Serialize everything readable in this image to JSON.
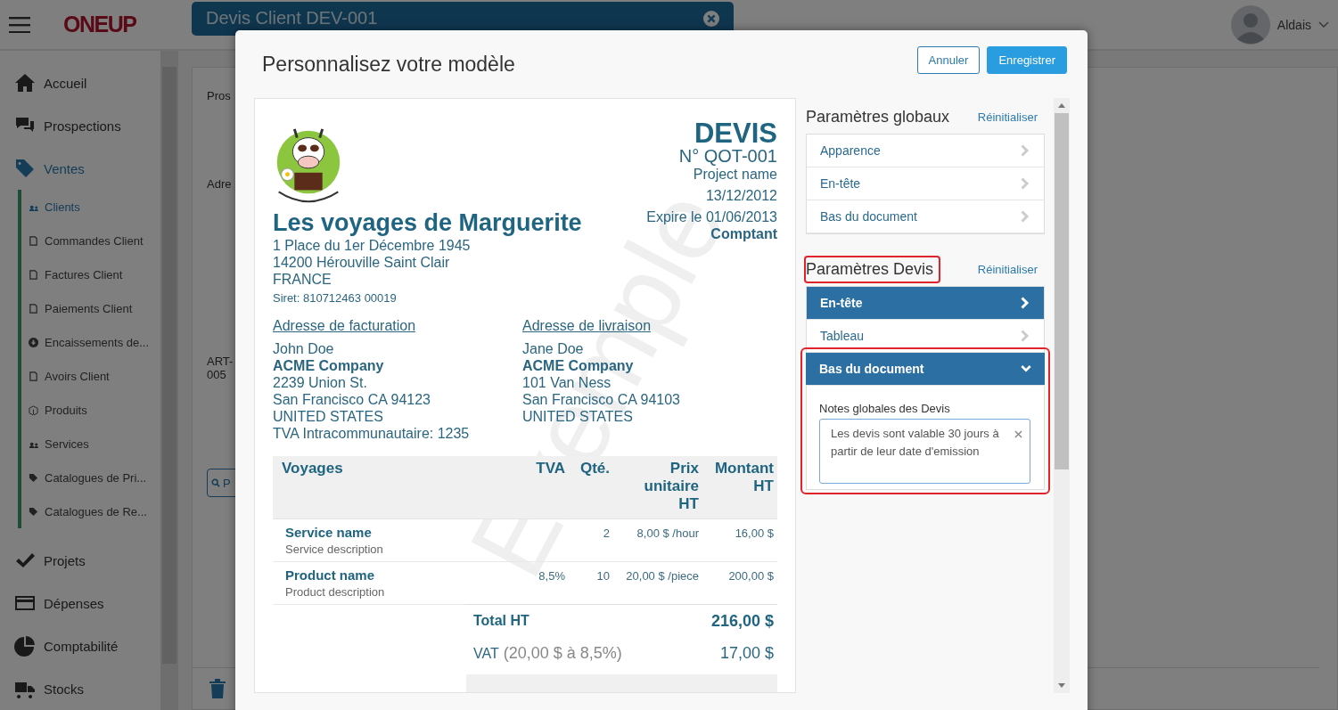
{
  "app": {
    "brand": "ONEUP",
    "tab_title": "Devis Client DEV-001",
    "user": "Aldais"
  },
  "sidebar": {
    "items": [
      {
        "label": "Accueil",
        "selected": false
      },
      {
        "label": "Prospections",
        "selected": false
      },
      {
        "label": "Ventes",
        "selected": true,
        "children": [
          {
            "label": "Clients",
            "selected": true
          },
          {
            "label": "Commandes Client",
            "selected": false
          },
          {
            "label": "Factures Client",
            "selected": false
          },
          {
            "label": "Paiements Client",
            "selected": false
          },
          {
            "label": "Encaissements de...",
            "selected": false
          },
          {
            "label": "Avoirs Client",
            "selected": false
          },
          {
            "label": "Produits",
            "selected": false
          },
          {
            "label": "Services",
            "selected": false
          },
          {
            "label": "Catalogues de Pri...",
            "selected": false
          },
          {
            "label": "Catalogues de Re...",
            "selected": false
          }
        ]
      },
      {
        "label": "Projets",
        "selected": false
      },
      {
        "label": "Dépenses",
        "selected": false
      },
      {
        "label": "Comptabilité",
        "selected": false
      },
      {
        "label": "Stocks",
        "selected": false
      }
    ]
  },
  "background_panel": {
    "fragments": [
      "Pros",
      "Adre",
      "ART-",
      "005"
    ],
    "search_button": "P"
  },
  "modal": {
    "title": "Personnalisez votre modèle",
    "buttons": [
      {
        "label": "Annuler",
        "kind": "secondary"
      },
      {
        "label": "Enregistrer",
        "kind": "primary"
      }
    ]
  },
  "preview": {
    "watermark": "Exemple",
    "doc_type": "DEVIS",
    "number": "N° QOT-001",
    "project": "Project name",
    "date": "13/12/2012",
    "expiry": "Expire le 01/06/2013",
    "payment": "Comptant",
    "company": {
      "name": "Les voyages de Marguerite",
      "lines": [
        "1 Place du 1er Décembre 1945",
        "14200 Hérouville Saint Clair",
        "FRANCE"
      ],
      "siret": "Siret: 810712463 00019"
    },
    "addresses": [
      {
        "heading": "Adresse de facturation",
        "contact": "John Doe",
        "company": "ACME Company",
        "lines": [
          "2239 Union St.",
          "San Francisco CA 94123",
          "UNITED STATES",
          "TVA Intracommunautaire: 1235"
        ]
      },
      {
        "heading": "Adresse de livraison",
        "contact": "Jane Doe",
        "company": "ACME Company",
        "lines": [
          "101 Van Ness",
          "San Francisco CA 94103",
          "UNITED STATES"
        ]
      }
    ],
    "table": {
      "columns": [
        "Voyages",
        "TVA",
        "Qté.",
        "Prix unitaire HT",
        "Montant HT"
      ],
      "rows": [
        {
          "name": "Service name",
          "description": "Service description",
          "qty": "2",
          "price": "8,00 $ /hour",
          "amount": "16,00 $"
        },
        {
          "name": "Product name",
          "description": "Product description",
          "tva": "8,5%",
          "qty": "10",
          "price": "20,00 $ /piece",
          "amount": "200,00 $"
        }
      ]
    },
    "totals": [
      {
        "label": "Total HT",
        "value": "216,00 $",
        "kind": "bold"
      },
      {
        "label": "VAT",
        "detail": "(20,00 $ à 8,5%)",
        "value": "17,00 $",
        "kind": "normal"
      }
    ]
  },
  "settings": [
    {
      "title": "Paramètres globaux",
      "reset": "Réinitialiser",
      "highlighted": false,
      "items": [
        {
          "label": "Apparence",
          "selected": false,
          "expanded": false,
          "highlighted": false
        },
        {
          "label": "En-tête",
          "selected": false,
          "expanded": false,
          "highlighted": false
        },
        {
          "label": "Bas du document",
          "selected": false,
          "expanded": false,
          "highlighted": false
        }
      ]
    },
    {
      "title": "Paramètres Devis",
      "reset": "Réinitialiser",
      "highlighted": true,
      "items": [
        {
          "label": "En-tête",
          "selected": true,
          "expanded": false,
          "highlighted": false
        },
        {
          "label": "Tableau",
          "selected": false,
          "expanded": false,
          "highlighted": false
        },
        {
          "label": "Bas du document",
          "selected": true,
          "expanded": true,
          "highlighted": true,
          "field": {
            "label": "Notes globales des Devis",
            "value": "Les devis sont valable 30 jours à partir de leur date d'emission"
          }
        }
      ]
    }
  ]
}
